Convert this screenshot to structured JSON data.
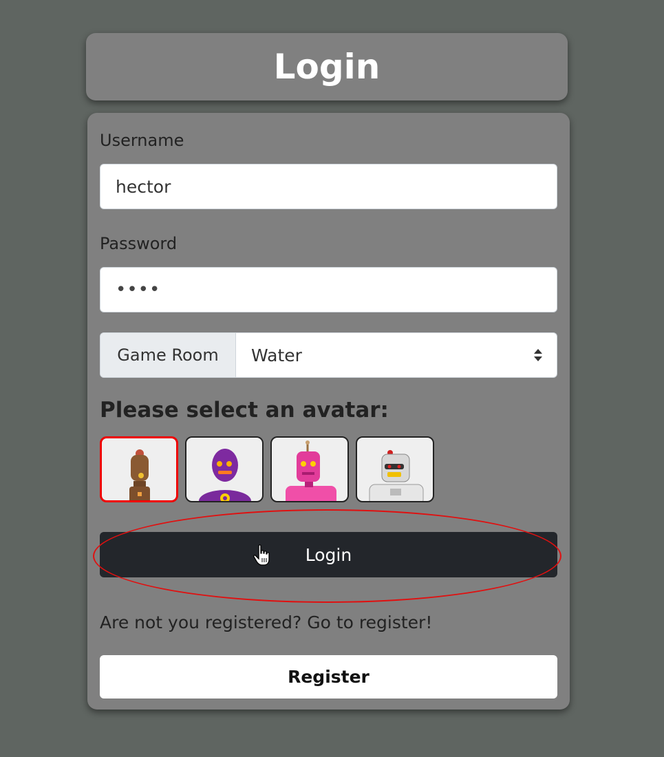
{
  "header": {
    "title": "Login"
  },
  "form": {
    "username_label": "Username",
    "username_value": "hector",
    "password_label": "Password",
    "password_value": "••••",
    "game_room_label": "Game Room",
    "game_room_value": "Water",
    "avatar_heading": "Please select an avatar:",
    "avatars": [
      {
        "name": "brown-robot",
        "selected": true
      },
      {
        "name": "purple-robot",
        "selected": false
      },
      {
        "name": "pink-robot",
        "selected": false
      },
      {
        "name": "white-robot",
        "selected": false
      }
    ],
    "login_button": "Login",
    "register_prompt": "Are not you registered? Go to register!",
    "register_button": "Register"
  },
  "colors": {
    "background": "#5f6561",
    "card": "#808080",
    "login_button": "#23262b",
    "selected_border": "#e00000",
    "highlight": "#e01010"
  }
}
